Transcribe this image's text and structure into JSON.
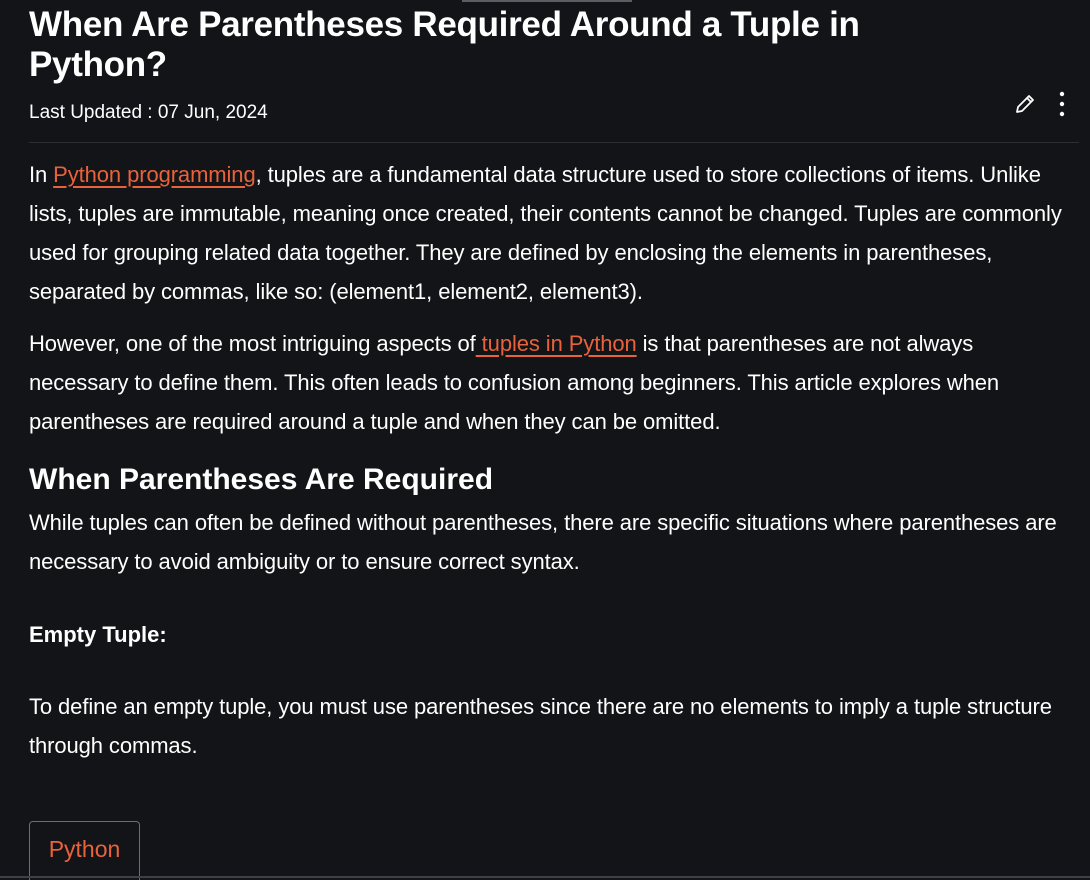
{
  "article": {
    "title": "When Are Parentheses Required Around a Tuple in Python?",
    "last_updated": "Last Updated : 07 Jun, 2024"
  },
  "actions": {
    "edit_icon": "pencil-icon",
    "more_icon": "vertical-dots-icon"
  },
  "intro": {
    "p1_before": "In ",
    "p1_link": "Python programming",
    "p1_after": ", tuples are a fundamental data structure used to store collections of items. Unlike lists, tuples are immutable, meaning once created, their contents cannot be changed. Tuples are commonly used for grouping related data together. They are defined by enclosing the elements in parentheses, separated by commas, like so: (element1, element2, element3).",
    "p2_before": "However, one of the most intriguing aspects of",
    "p2_link": " tuples in Python",
    "p2_after": " is that parentheses are not always necessary to define them. This often leads to confusion among beginners. This article explores when parentheses are required around a tuple and when they can be omitted."
  },
  "section": {
    "heading": "When Parentheses Are Required",
    "text": "While tuples can often be defined without parentheses, there are specific situations where parentheses are necessary to avoid ambiguity or to ensure correct syntax.",
    "subheading": "Empty Tuple:",
    "subtext": "To define an empty tuple, you must use parentheses since there are no elements to imply a tuple structure through commas."
  },
  "code_tabs": [
    "Python"
  ],
  "colors": {
    "background": "#131417",
    "link": "#e8623c",
    "text": "#ffffff"
  }
}
